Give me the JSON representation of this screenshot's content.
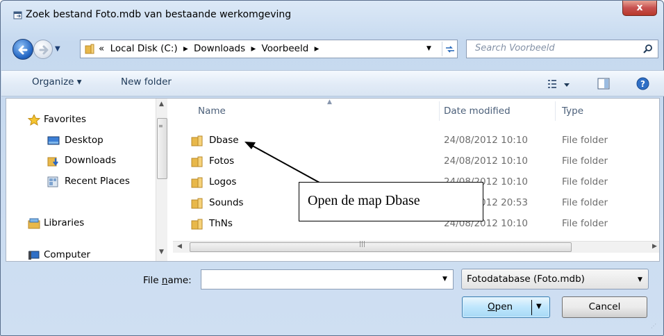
{
  "window": {
    "title": "Zoek bestand Foto.mdb van bestaande werkomgeving",
    "close_label": "x"
  },
  "address_bar": {
    "overflow": "«",
    "crumbs": [
      "Local Disk (C:)",
      "Downloads",
      "Voorbeeld"
    ],
    "separator": "▸"
  },
  "search": {
    "placeholder": "Search Voorbeeld"
  },
  "toolbar": {
    "organize_label": "Organize ▾",
    "new_folder_label": "New folder"
  },
  "navigation": {
    "items": [
      {
        "label": "Favorites",
        "icon": "star-icon"
      },
      {
        "label": "Desktop",
        "icon": "desktop-icon"
      },
      {
        "label": "Downloads",
        "icon": "downloads-folder-icon"
      },
      {
        "label": "Recent Places",
        "icon": "recent-places-icon"
      },
      {
        "label": "Libraries",
        "icon": "libraries-icon"
      },
      {
        "label": "Computer",
        "icon": "computer-icon"
      }
    ]
  },
  "file_list": {
    "columns": [
      "Name",
      "Date modified",
      "Type"
    ],
    "rows": [
      {
        "name": "Dbase",
        "date": "24/08/2012 10:10",
        "type": "File folder"
      },
      {
        "name": "Fotos",
        "date": "24/08/2012 10:10",
        "type": "File folder"
      },
      {
        "name": "Logos",
        "date": "24/08/2012 10:10",
        "type": "File folder"
      },
      {
        "name": "Sounds",
        "date": "24/08/2012 20:53",
        "type": "File folder"
      },
      {
        "name": "ThNs",
        "date": "24/08/2012 10:10",
        "type": "File folder"
      }
    ]
  },
  "bottom": {
    "file_name_label_pre": "File ",
    "file_name_label_u": "n",
    "file_name_label_post": "ame:",
    "file_name_value": "",
    "filter_value": "Fotodatabase (Foto.mdb)",
    "open_label_u": "O",
    "open_label_rest": "pen",
    "cancel_label": "Cancel"
  },
  "callout": {
    "text": "Open de map Dbase"
  },
  "colors": {
    "accent": "#2467c4",
    "close": "#c75050",
    "folder": "#e8b84a"
  }
}
